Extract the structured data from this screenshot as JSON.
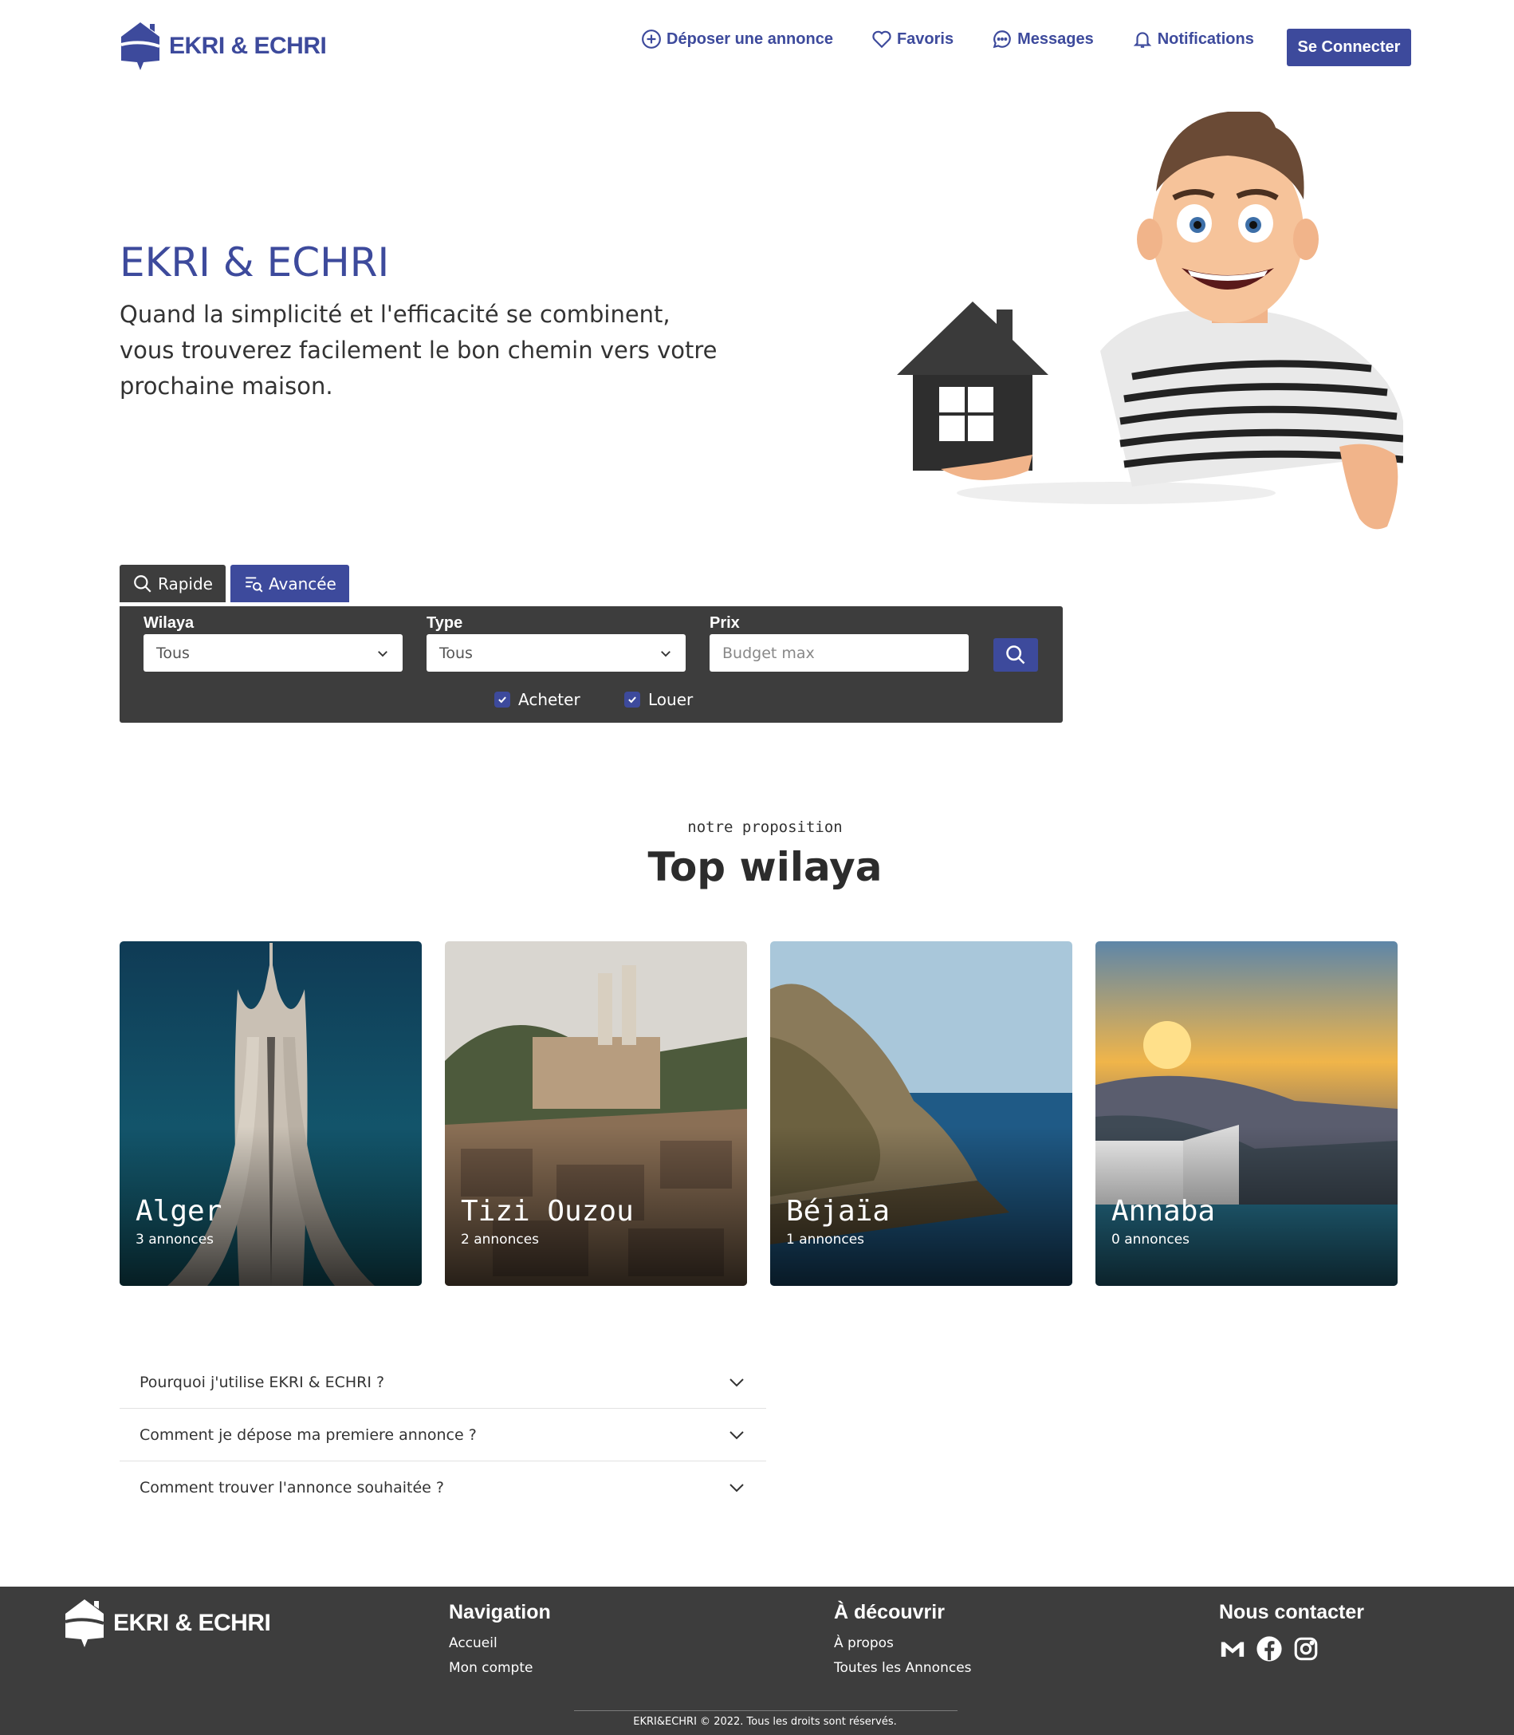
{
  "brand": {
    "name": "EKRI & ECHRI",
    "primary_color": "#3d4a9c",
    "dark_color": "#3d3d3d"
  },
  "header": {
    "nav": [
      {
        "label": "Déposer une annonce",
        "icon": "plus-circle-icon"
      },
      {
        "label": "Favoris",
        "icon": "heart-icon"
      },
      {
        "label": "Messages",
        "icon": "chat-icon"
      },
      {
        "label": "Notifications",
        "icon": "bell-icon"
      }
    ],
    "login_label": "Se Connecter"
  },
  "hero": {
    "title": "EKRI & ECHRI",
    "line1": "Quand la simplicité et l'efficacité se combinent,",
    "line2": "vous trouverez facilement le bon chemin vers votre prochaine maison.",
    "illustration": "cartoon-man-holding-house"
  },
  "search": {
    "tabs": [
      {
        "label": "Rapide",
        "icon": "search-icon"
      },
      {
        "label": "Avancée",
        "icon": "filter-search-icon"
      }
    ],
    "wilaya": {
      "label": "Wilaya",
      "value": "Tous"
    },
    "type": {
      "label": "Type",
      "value": "Tous"
    },
    "price": {
      "label": "Prix",
      "placeholder": "Budget max"
    },
    "checks": [
      {
        "label": "Acheter",
        "checked": true
      },
      {
        "label": "Louer",
        "checked": true
      }
    ]
  },
  "top_wilaya": {
    "kicker": "notre proposition",
    "title": "Top wilaya",
    "cards": [
      {
        "name": "Alger",
        "count": "3 annonces"
      },
      {
        "name": "Tizi Ouzou",
        "count": "2 annonces"
      },
      {
        "name": "Béjaïa",
        "count": "1 annonces"
      },
      {
        "name": "Annaba",
        "count": "0 annonces"
      }
    ]
  },
  "faq": [
    {
      "question": "Pourquoi j'utilise EKRI & ECHRI ?"
    },
    {
      "question": "Comment je dépose ma premiere annonce ?"
    },
    {
      "question": "Comment trouver l'annonce souhaitée ?"
    }
  ],
  "footer": {
    "navigation": {
      "title": "Navigation",
      "links": [
        "Accueil",
        "Mon compte"
      ]
    },
    "discover": {
      "title": "À découvrir",
      "links": [
        "À propos",
        "Toutes les Annonces"
      ]
    },
    "contact": {
      "title": "Nous contacter",
      "icons": [
        "gmail-icon",
        "facebook-icon",
        "instagram-icon"
      ]
    },
    "copyright": "EKRI&ECHRI © 2022. Tous les droits sont réservés."
  }
}
